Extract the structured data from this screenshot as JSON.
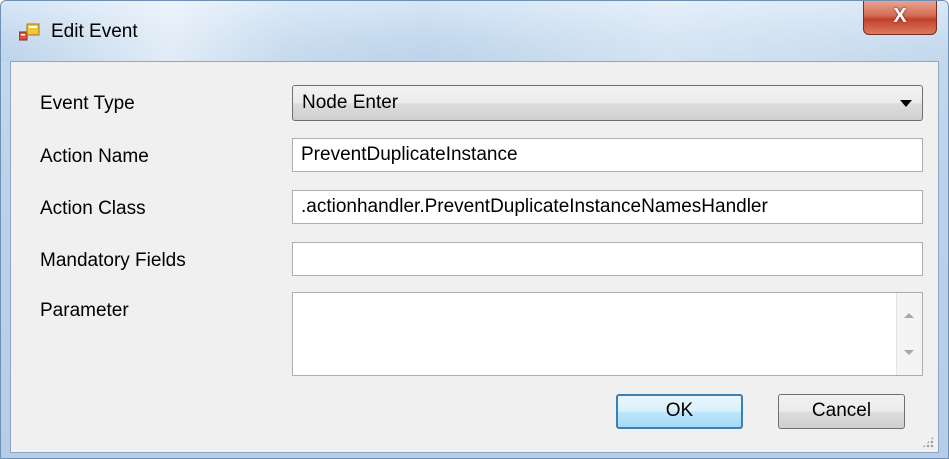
{
  "window": {
    "title": "Edit Event",
    "close_glyph": "X",
    "icon": "window-app-icon"
  },
  "form": {
    "event_type": {
      "label": "Event Type",
      "value": "Node Enter"
    },
    "action_name": {
      "label": "Action Name",
      "value": "PreventDuplicateInstance"
    },
    "action_class": {
      "label": "Action Class",
      "value": ".actionhandler.PreventDuplicateInstanceNamesHandler"
    },
    "mandatory_fields": {
      "label": "Mandatory Fields",
      "value": ""
    },
    "parameter": {
      "label": "Parameter",
      "value": ""
    }
  },
  "buttons": {
    "ok": "OK",
    "cancel": "Cancel"
  },
  "colors": {
    "default_button_border": "#3c7fb1",
    "close_button": "#c2412a"
  }
}
